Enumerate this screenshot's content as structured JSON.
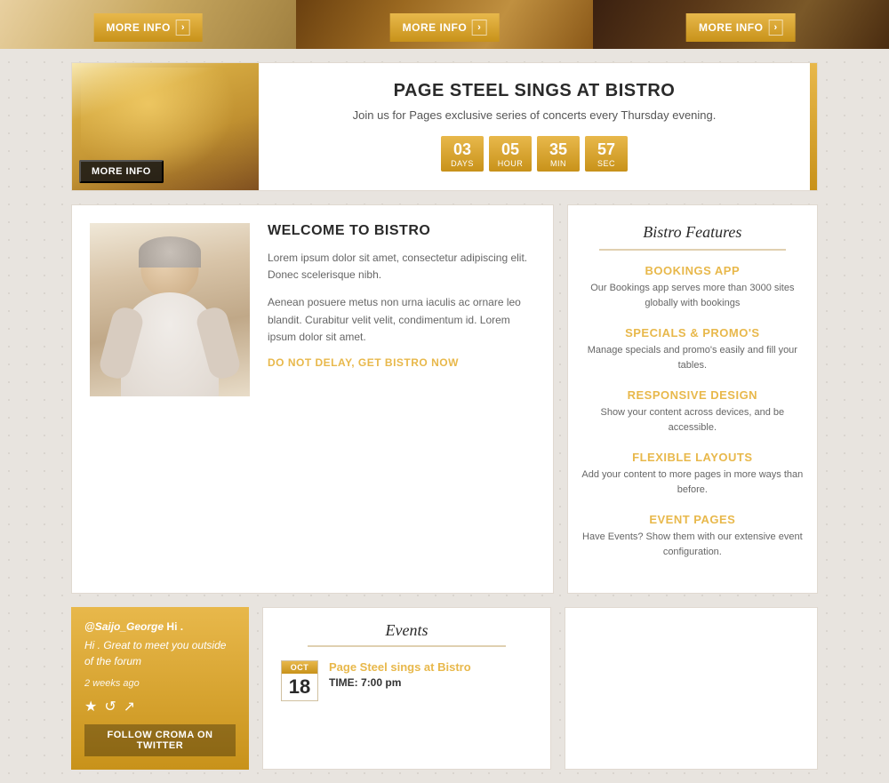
{
  "top_banners": [
    {
      "id": "banner-1",
      "more_info_label": "MORE INFO",
      "bg_class": "strip1"
    },
    {
      "id": "banner-2",
      "more_info_label": "MORE INFO",
      "bg_class": "strip2"
    },
    {
      "id": "banner-3",
      "more_info_label": "MORE INFO",
      "bg_class": "strip3"
    }
  ],
  "event_banner": {
    "title": "PAGE STEEL SINGS AT BISTRO",
    "subtitle": "Join us for Pages exclusive series of concerts every Thursday evening.",
    "more_info_label": "MORE INFO",
    "countdown": [
      {
        "value": "03",
        "label": "DAYS"
      },
      {
        "value": "05",
        "label": "HOUR"
      },
      {
        "value": "35",
        "label": "MIN"
      },
      {
        "value": "57",
        "label": "SEC"
      }
    ]
  },
  "welcome": {
    "title": "WELCOME TO BISTRO",
    "para1": "Lorem ipsum dolor sit amet, consectetur adipiscing elit. Donec scelerisque nibh.",
    "para2": "Aenean posuere metus non urna iaculis ac ornare leo blandit. Curabitur velit velit, condimentum id. Lorem ipsum dolor sit amet.",
    "cta": "DO NOT DELAY, GET BISTRO NOW"
  },
  "features": {
    "title": "Bistro Features",
    "items": [
      {
        "name": "BOOKINGS APP",
        "desc": "Our Bookings app serves more than 3000 sites globally with bookings"
      },
      {
        "name": "SPECIALS & PROMO'S",
        "desc": "Manage specials and promo's easily and fill your tables."
      },
      {
        "name": "RESPONSIVE DESIGN",
        "desc": "Show your content across devices, and be accessible."
      },
      {
        "name": "FLEXIBLE LAYOUTS",
        "desc": "Add your content to more pages in more ways than before."
      },
      {
        "name": "EVENT PAGES",
        "desc": "Have Events? Show them with our extensive event configuration."
      }
    ]
  },
  "twitter": {
    "handle": "@Saijo_George",
    "message": "Hi . Great to meet you outside of the forum",
    "time": "2 weeks ago",
    "follow_label": "FOLLOW CROMA ON TWITTER"
  },
  "events": {
    "title": "Events",
    "items": [
      {
        "month": "OCT",
        "day": "18",
        "title": "Page Steel sings at Bistro",
        "time_label": "TIME:",
        "time_value": "7:00 pm"
      }
    ]
  }
}
